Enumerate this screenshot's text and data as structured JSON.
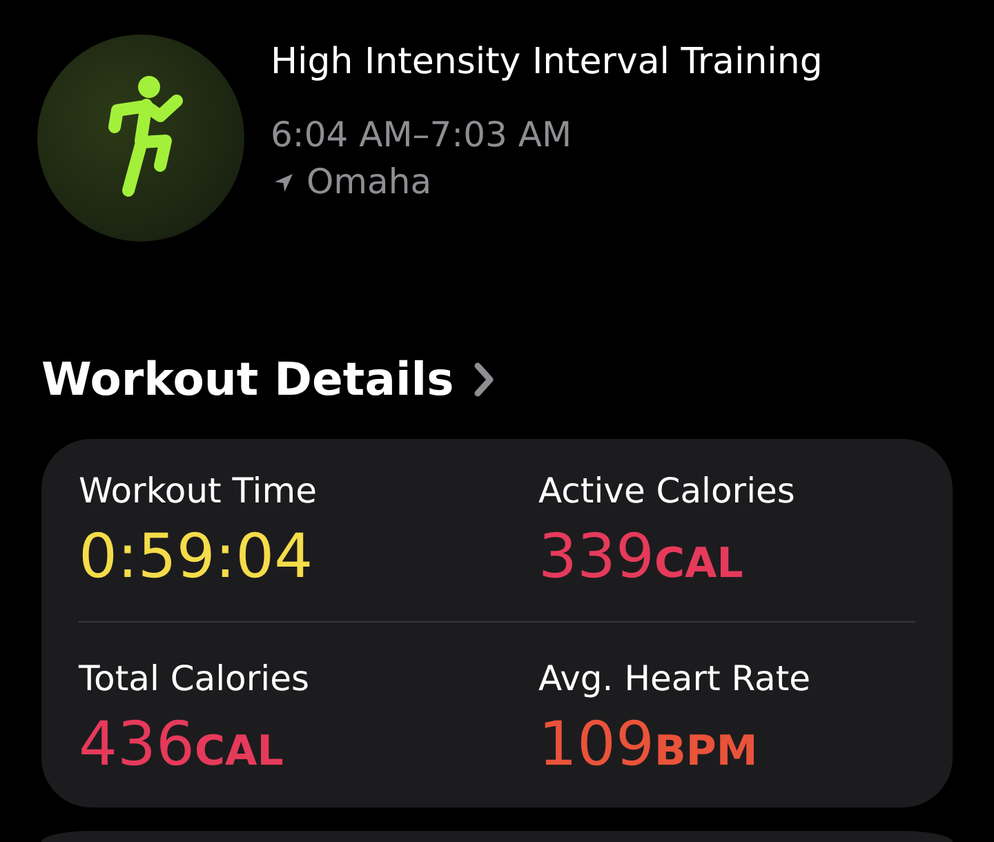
{
  "workout": {
    "title": "High Intensity Interval Training",
    "time_range": "6:04 AM–7:03 AM",
    "location": "Omaha"
  },
  "details": {
    "title": "Workout Details",
    "metrics": [
      {
        "label": "Workout Time",
        "value": "0:59:04",
        "color": "#f5dc4a"
      },
      {
        "label": "Active Calories",
        "value": "339",
        "unit": "CAL",
        "color": "#e63a5b"
      },
      {
        "label": "Total Calories",
        "value": "436",
        "unit": "CAL",
        "color": "#e63a5b"
      },
      {
        "label": "Avg. Heart Rate",
        "value": "109",
        "unit": "BPM",
        "color": "#e9533a"
      }
    ]
  }
}
